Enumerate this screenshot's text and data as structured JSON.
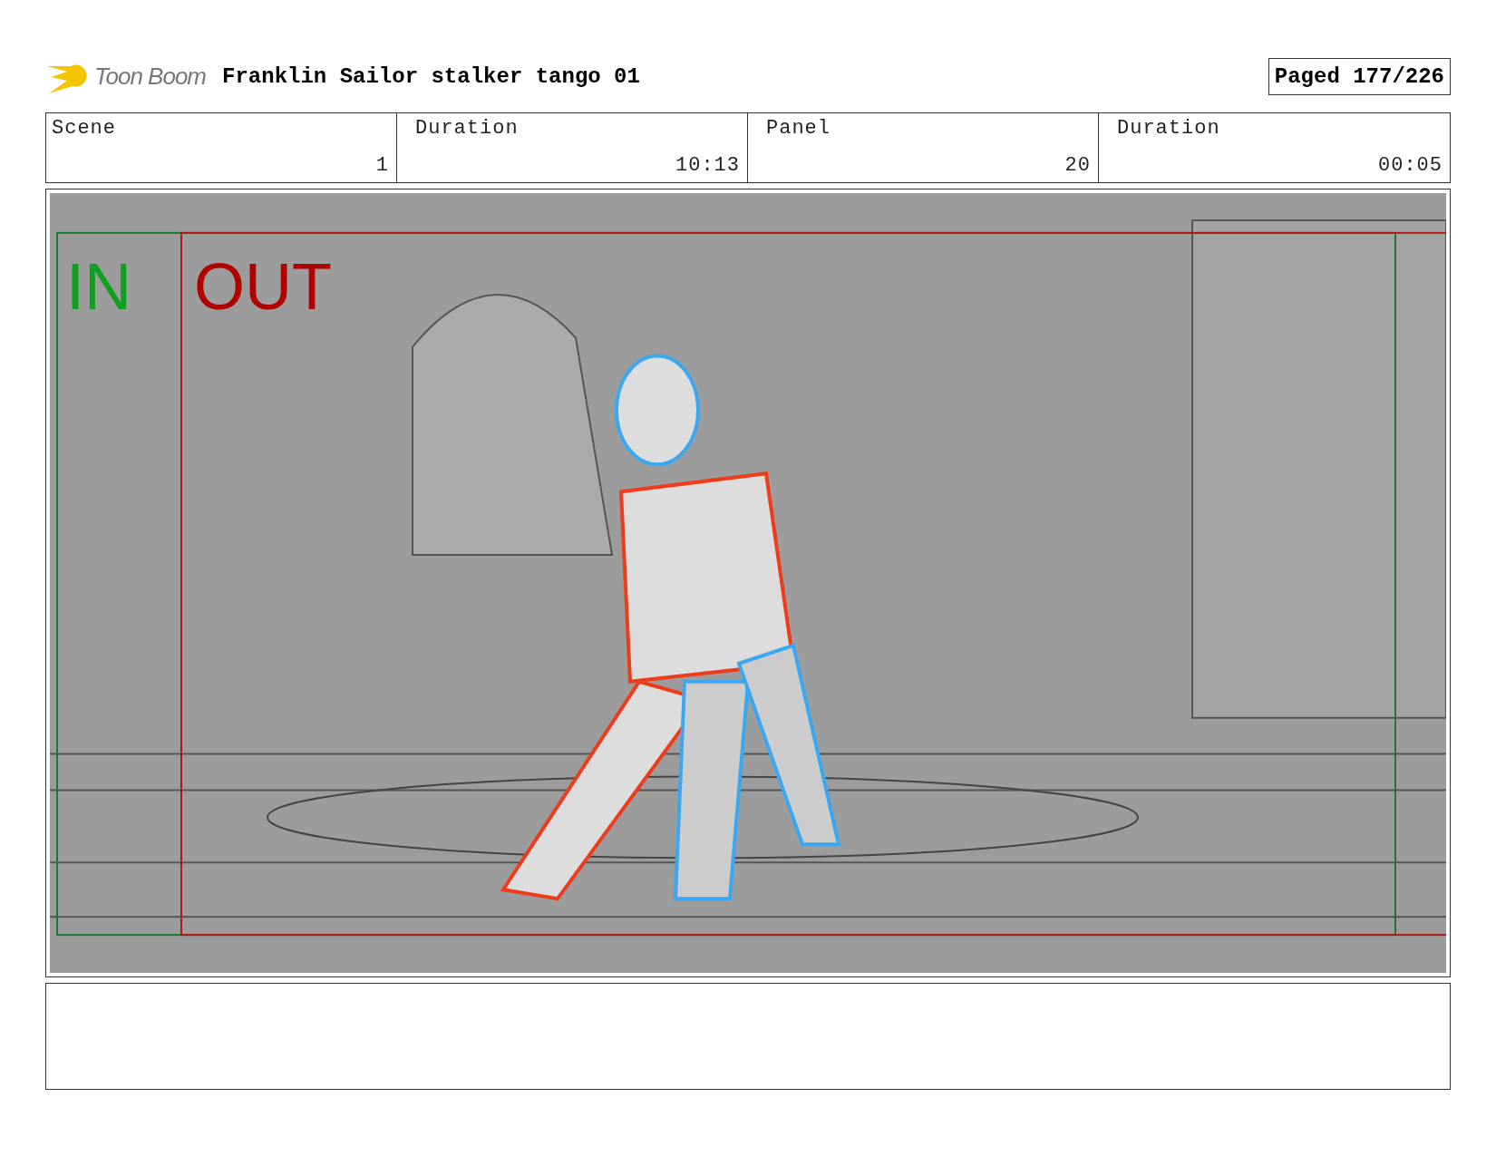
{
  "header": {
    "logo_text": "Toon Boom",
    "title": "Franklin Sailor stalker tango 01",
    "page": "Paged 177/226"
  },
  "info": [
    {
      "label": "Scene",
      "value": "1"
    },
    {
      "label": "Duration",
      "value": "10:13"
    },
    {
      "label": "Panel",
      "value": "20"
    },
    {
      "label": "Duration",
      "value": "00:05"
    }
  ],
  "panel": {
    "in_label": "IN",
    "out_label": "OUT"
  }
}
